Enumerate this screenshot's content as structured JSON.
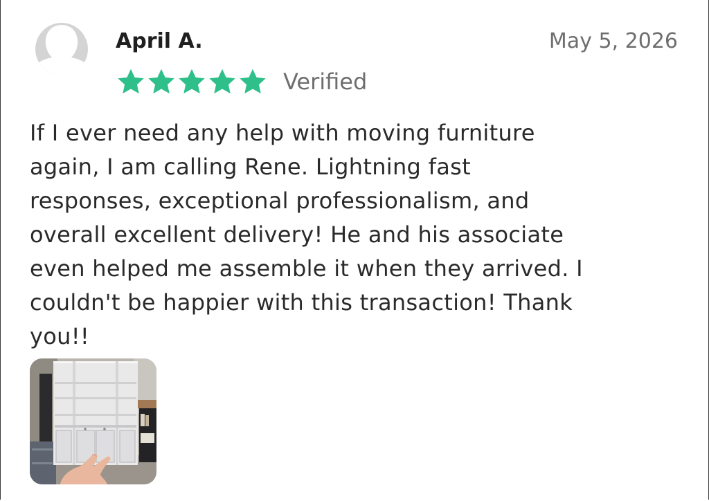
{
  "review": {
    "reviewer_name": "April A.",
    "date": "May 5, 2026",
    "rating": 5,
    "rating_max": 5,
    "verified_label": "Verified",
    "body": "If I ever need any help with moving furniture\nagain, I am calling Rene. Lightning fast\nresponses, exceptional professionalism, and\noverall excellent delivery! He and his associate\neven helped me assemble it when they arrived. I\ncouldn't be happier with this transaction!  Thank\nyou!!"
  },
  "colors": {
    "star": "#2ebf8a",
    "avatar": "#d4d4d4",
    "muted_text": "#6e6e6e"
  },
  "icons": {
    "avatar": "default-user-avatar-icon",
    "star": "star-icon"
  }
}
